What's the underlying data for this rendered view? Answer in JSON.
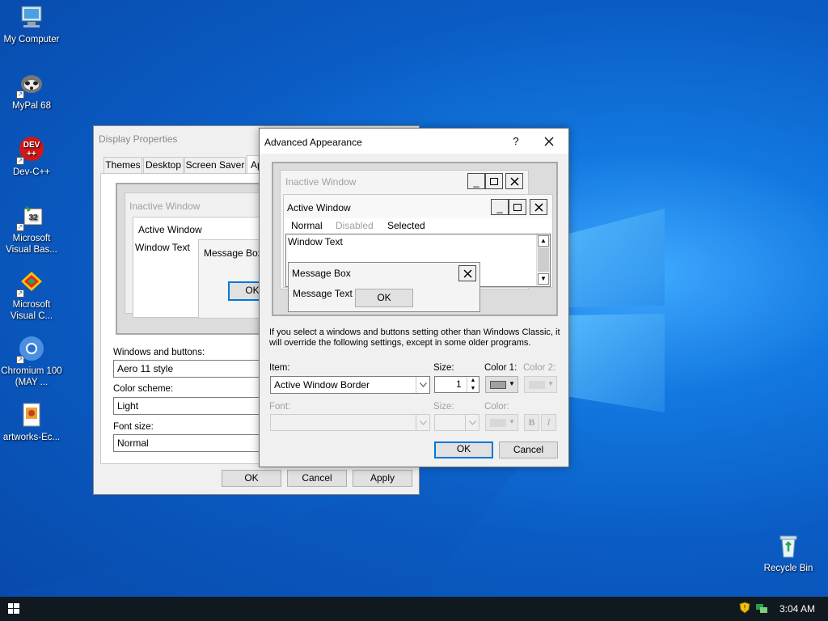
{
  "desktop": {
    "icons": [
      {
        "label": "My Computer",
        "icon": "computer-icon"
      },
      {
        "label": "MyPal 68",
        "icon": "mypal-icon"
      },
      {
        "label": "Dev-C++",
        "icon": "devcpp-icon"
      },
      {
        "label": "Microsoft Visual Bas...",
        "icon": "vb-icon"
      },
      {
        "label": "Microsoft Visual C...",
        "icon": "vc-icon"
      },
      {
        "label": "Chromium 100 (MAY ...",
        "icon": "chromium-icon"
      },
      {
        "label": "artworks-Ec...",
        "icon": "image-file-icon"
      },
      {
        "label": "Recycle Bin",
        "icon": "recycle-bin-icon"
      }
    ]
  },
  "taskbar": {
    "clock": "3:04 AM"
  },
  "display_properties": {
    "title": "Display Properties",
    "tabs": [
      "Themes",
      "Desktop",
      "Screen Saver",
      "Ap"
    ],
    "preview": {
      "inactive": "Inactive Window",
      "active": "Active Window",
      "window_text": "Window Text",
      "message_box": "Message Box",
      "ok": "OK"
    },
    "windows_buttons_label": "Windows and buttons:",
    "windows_buttons_value": "Aero 11 style",
    "color_scheme_label": "Color scheme:",
    "color_scheme_value": "Light",
    "font_size_label": "Font size:",
    "font_size_value": "Normal",
    "buttons": {
      "ok": "OK",
      "cancel": "Cancel",
      "apply": "Apply"
    }
  },
  "advanced": {
    "title": "Advanced Appearance",
    "help": "?",
    "preview": {
      "inactive": "Inactive Window",
      "active": "Active Window",
      "menu": [
        "Normal",
        "Disabled",
        "Selected"
      ],
      "window_text": "Window Text",
      "message_box": "Message Box",
      "message_text": "Message Text",
      "ok": "OK"
    },
    "info": "If you select a windows and buttons setting other than Windows Classic, it will override the following settings, except in some older programs.",
    "item_label": "Item:",
    "item_value": "Active Window Border",
    "size_label": "Size:",
    "size_value": "1",
    "color1_label": "Color 1:",
    "color2_label": "Color 2:",
    "font_label": "Font:",
    "font_size_label": "Size:",
    "font_color_label": "Color:",
    "bold": "B",
    "italic": "I",
    "buttons": {
      "ok": "OK",
      "cancel": "Cancel"
    }
  }
}
